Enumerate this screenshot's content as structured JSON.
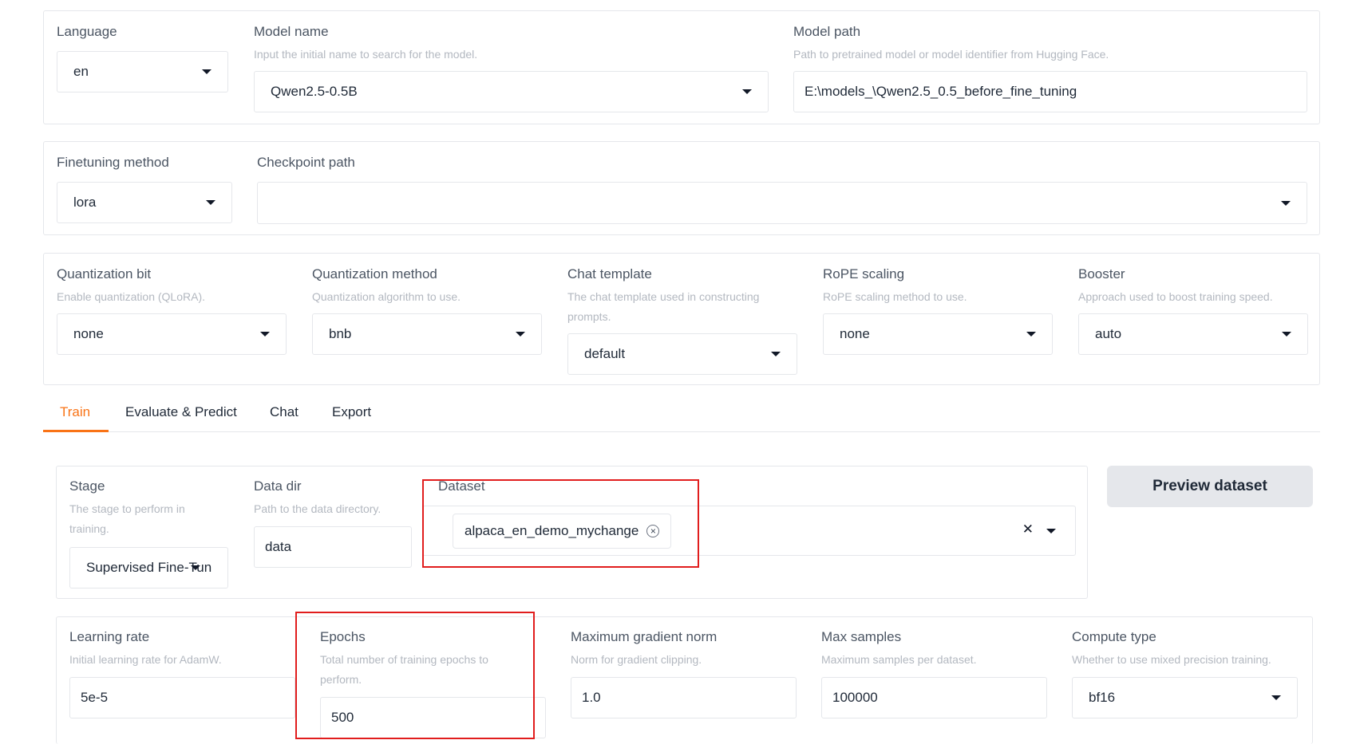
{
  "top": {
    "language": {
      "label": "Language",
      "value": "en"
    },
    "model_name": {
      "label": "Model name",
      "hint": "Input the initial name to search for the model.",
      "value": "Qwen2.5-0.5B"
    },
    "model_path": {
      "label": "Model path",
      "hint": "Path to pretrained model or model identifier from Hugging Face.",
      "value": "E:\\models_\\Qwen2.5_0.5_before_fine_tuning"
    }
  },
  "finetune": {
    "method": {
      "label": "Finetuning method",
      "value": "lora"
    },
    "checkpoint": {
      "label": "Checkpoint path",
      "value": ""
    }
  },
  "advanced": {
    "quant_bit": {
      "label": "Quantization bit",
      "hint": "Enable quantization (QLoRA).",
      "value": "none"
    },
    "quant_method": {
      "label": "Quantization method",
      "hint": "Quantization algorithm to use.",
      "value": "bnb"
    },
    "chat_template": {
      "label": "Chat template",
      "hint": "The chat template used in constructing prompts.",
      "value": "default"
    },
    "rope": {
      "label": "RoPE scaling",
      "hint": "RoPE scaling method to use.",
      "value": "none"
    },
    "booster": {
      "label": "Booster",
      "hint": "Approach used to boost training speed.",
      "value": "auto"
    }
  },
  "tabs": [
    "Train",
    "Evaluate & Predict",
    "Chat",
    "Export"
  ],
  "train": {
    "stage": {
      "label": "Stage",
      "hint": "The stage to perform in training.",
      "value": "Supervised Fine-Tun"
    },
    "data_dir": {
      "label": "Data dir",
      "hint": "Path to the data directory.",
      "value": "data"
    },
    "dataset": {
      "label": "Dataset",
      "chip": "alpaca_en_demo_mychange",
      "chip_remove": "×",
      "clear": "✕"
    },
    "preview_button": "Preview dataset",
    "learning_rate": {
      "label": "Learning rate",
      "hint": "Initial learning rate for AdamW.",
      "value": "5e-5"
    },
    "epochs": {
      "label": "Epochs",
      "hint": "Total number of training epochs to perform.",
      "value": "500"
    },
    "max_grad_norm": {
      "label": "Maximum gradient norm",
      "hint": "Norm for gradient clipping.",
      "value": "1.0"
    },
    "max_samples": {
      "label": "Max samples",
      "hint": "Maximum samples per dataset.",
      "value": "100000"
    },
    "compute_type": {
      "label": "Compute type",
      "hint": "Whether to use mixed precision training.",
      "value": "bf16"
    }
  },
  "colors": {
    "accent": "#f97316",
    "highlight": "#e11d1d"
  }
}
